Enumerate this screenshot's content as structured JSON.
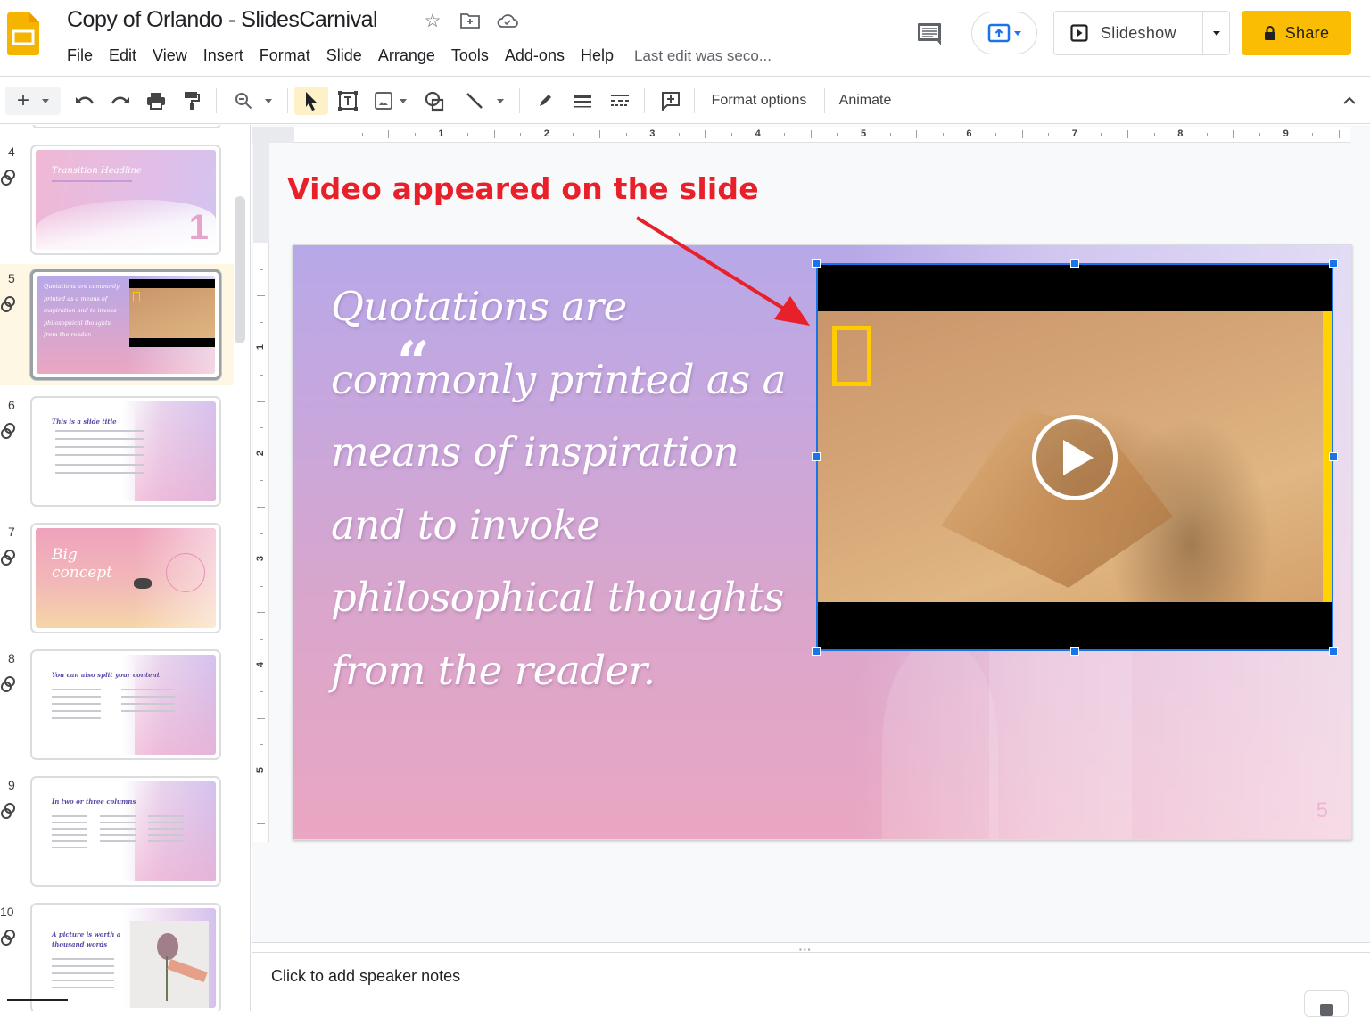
{
  "header": {
    "doc_title": "Copy of Orlando - SlidesCarnival",
    "title_icons": [
      "star-icon",
      "move-to-folder-icon",
      "cloud-saved-icon"
    ],
    "menu": [
      "File",
      "Edit",
      "View",
      "Insert",
      "Format",
      "Slide",
      "Arrange",
      "Tools",
      "Add-ons",
      "Help"
    ],
    "last_edit": "Last edit was seco...",
    "slideshow_label": "Slideshow",
    "share_label": "Share",
    "accent_color": "#fbbc04"
  },
  "toolbar": {
    "format_options_label": "Format options",
    "animate_label": "Animate"
  },
  "filmstrip": {
    "slides": [
      {
        "number": "4",
        "title": "Transition Headline",
        "big_number": "1"
      },
      {
        "number": "5",
        "title": "Quotations are commonly printed as a means of inspiration and to invoke philosophical thoughts from the reader.",
        "selected": true
      },
      {
        "number": "6",
        "title": "This is a slide title"
      },
      {
        "number": "7",
        "title": "Big concept"
      },
      {
        "number": "8",
        "title": "You can also split your content"
      },
      {
        "number": "9",
        "title": "In two or three columns"
      },
      {
        "number": "10",
        "title": "A picture is worth a thousand words"
      }
    ]
  },
  "ruler": {
    "horizontal": [
      "1",
      "2",
      "3",
      "4",
      "5",
      "6",
      "7",
      "8",
      "9"
    ],
    "vertical": [
      "1",
      "2",
      "3",
      "4",
      "5"
    ]
  },
  "annotation": {
    "text": "Video appeared on the slide",
    "color": "#e8202a"
  },
  "slide": {
    "quote_mark": "“",
    "quote_lines": [
      "Quotations are",
      "commonly printed as a",
      "means of inspiration",
      "and to invoke",
      "philosophical thoughts",
      "from the reader."
    ],
    "slide_number": "5",
    "video": {
      "state": "paused",
      "selected": true,
      "play_icon": "play-icon"
    }
  },
  "notes": {
    "placeholder": "Click to add speaker notes"
  }
}
